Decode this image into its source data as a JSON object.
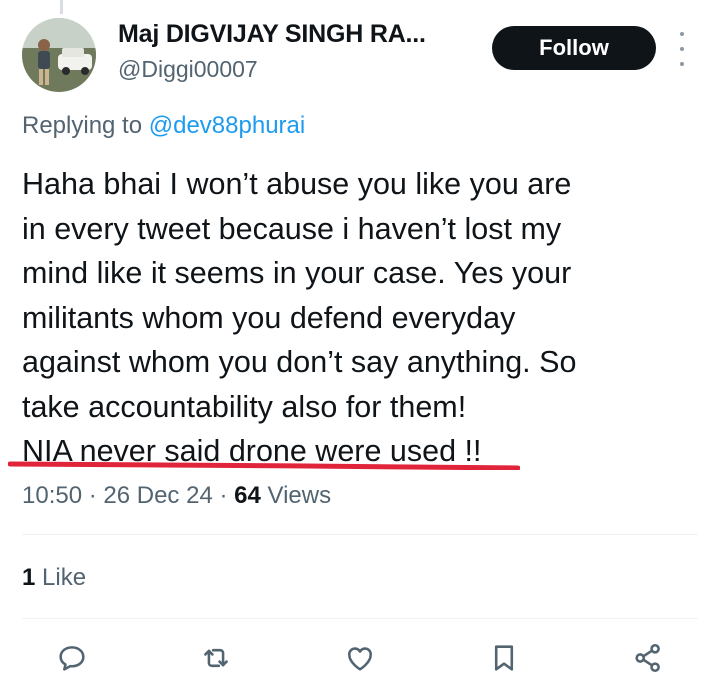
{
  "author": {
    "display_name": "Maj DIGVIJAY SINGH RA...",
    "handle": "@Diggi00007",
    "avatar_icon": "profile-photo"
  },
  "follow_label": "Follow",
  "more_icon": "more-vertical-icon",
  "reply_context": {
    "prefix": "Replying to",
    "mention": "@dev88phurai"
  },
  "tweet": {
    "lines": [
      "Haha bhai I won’t abuse you like you are",
      "in every tweet because i haven’t lost my",
      "mind like it seems in your case. Yes your",
      "militants whom you defend everyday",
      "against whom you don’t say anything. So",
      "take accountability also for them!",
      "NIA never said drone were used !!"
    ]
  },
  "meta": {
    "time": "10:50",
    "sep1": " · ",
    "date": "26 Dec 24",
    "sep2": " · ",
    "views_count": "64",
    "views_label": " Views"
  },
  "engagement": {
    "likes_count": "1",
    "likes_label": " Like"
  },
  "actions": [
    "reply-icon",
    "retweet-icon",
    "like-icon",
    "bookmark-icon",
    "share-icon"
  ],
  "colors": {
    "mention_blue": "#1d9bf0",
    "secondary_text": "#536471",
    "underline_red": "#e0243a",
    "follow_bg": "#0f1419"
  }
}
